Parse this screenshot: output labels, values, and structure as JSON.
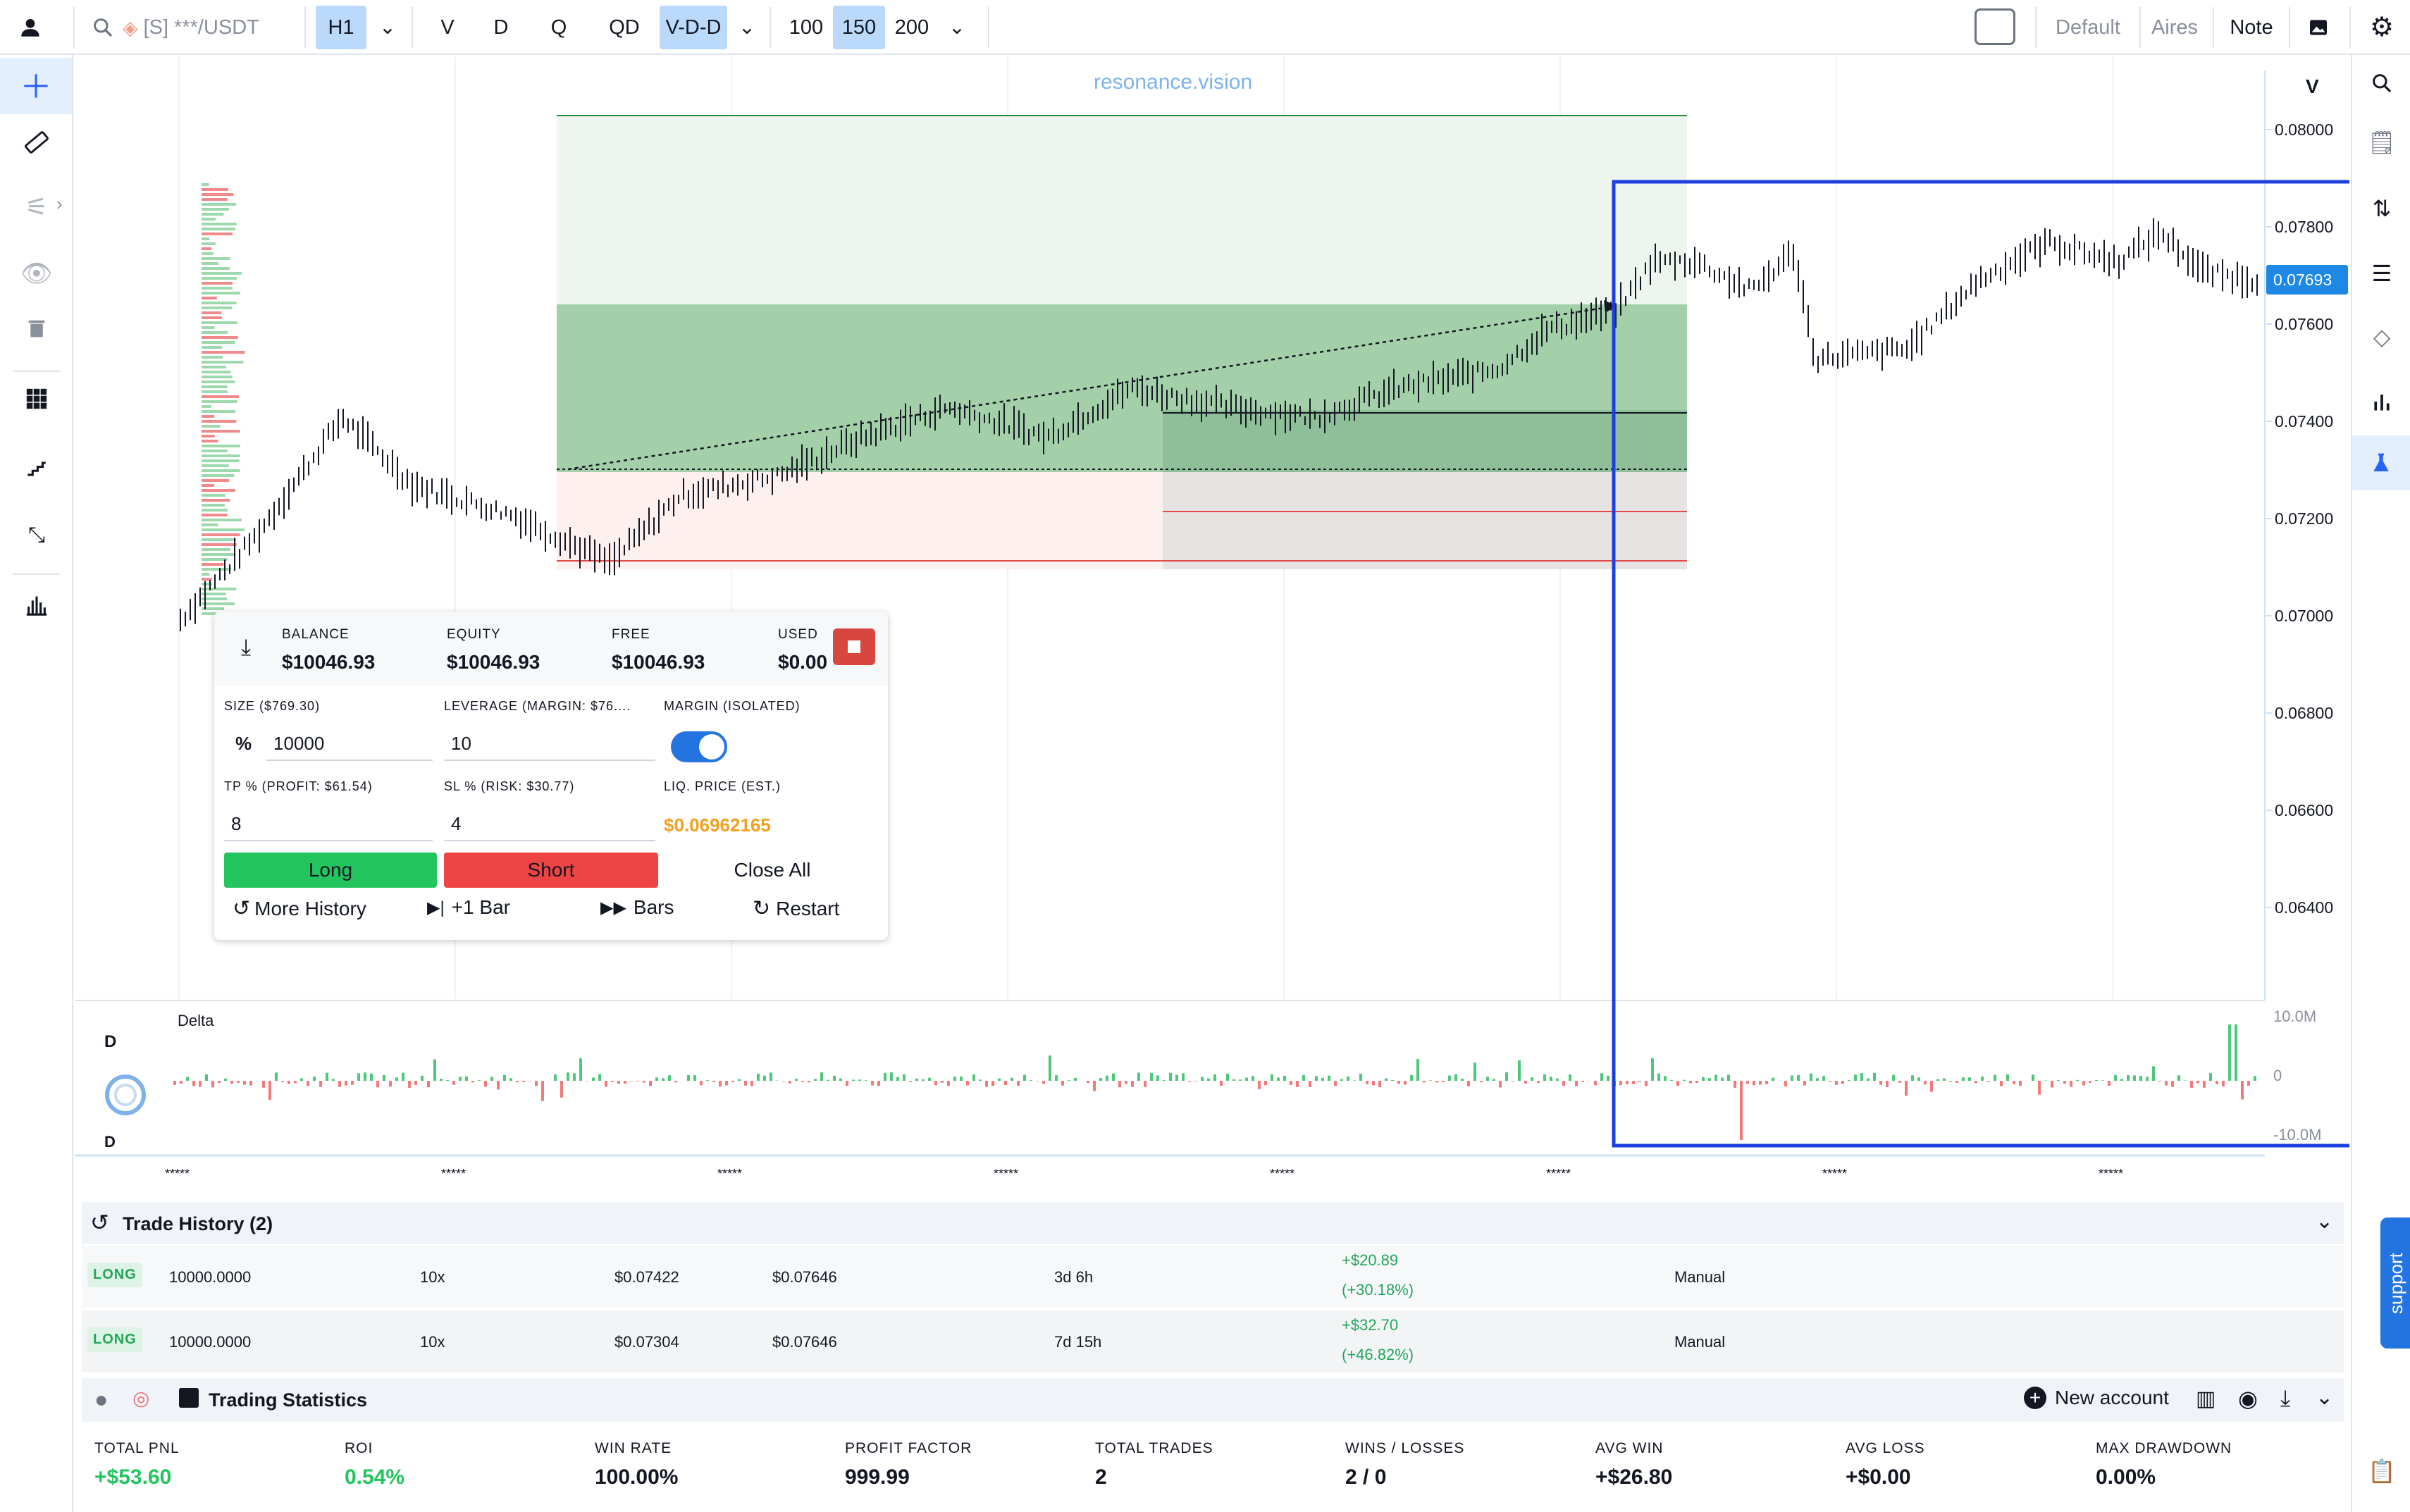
{
  "topbar": {
    "symbol": "[S] ***/USDT",
    "timeframe": "H1",
    "tf_options": [
      "V",
      "D",
      "Q",
      "QD"
    ],
    "vdd": "V-D-D",
    "bars": [
      "100",
      "150",
      "200"
    ],
    "layout_default": "Default",
    "layout_aires": "Aires",
    "note": "Note"
  },
  "chart": {
    "watermark": "resonance.vision",
    "scale_label": "V",
    "price_ticks": [
      "0.08000",
      "0.07800",
      "0.07600",
      "0.07400",
      "0.07200",
      "0.07000",
      "0.06800",
      "0.06600",
      "0.06400"
    ],
    "current_price": "0.07693",
    "x_ticks": [
      "*****",
      "*****",
      "*****",
      "*****",
      "*****",
      "*****",
      "*****",
      "*****"
    ],
    "delta_title": "Delta",
    "delta_ticks": [
      "10.0M",
      "0",
      "-10.0M"
    ],
    "d_label_top": "D",
    "d_label_bottom": "D"
  },
  "trade_panel": {
    "balance_label": "BALANCE",
    "balance": "$10046.93",
    "equity_label": "EQUITY",
    "equity": "$10046.93",
    "free_label": "FREE",
    "free": "$10046.93",
    "used_label": "USED",
    "used": "$0.00",
    "size_label": "SIZE ($769.30)",
    "size_unit": "%",
    "size_value": "10000",
    "leverage_label": "LEVERAGE (MARGIN: $76....",
    "leverage_value": "10",
    "margin_label": "MARGIN (ISOLATED)",
    "tp_label": "TP % (PROFIT: $61.54)",
    "tp_value": "8",
    "sl_label": "SL % (RISK: $30.77)",
    "sl_value": "4",
    "liq_label": "LIQ. PRICE (EST.)",
    "liq_value": "$0.06962165",
    "long": "Long",
    "short": "Short",
    "close_all": "Close All",
    "more_history": "More History",
    "plus_bar": "+1 Bar",
    "bars": "Bars",
    "restart": "Restart"
  },
  "trade_history": {
    "title": "Trade History (2)",
    "rows": [
      {
        "side": "LONG",
        "size": "10000.0000",
        "lev": "10x",
        "entry": "$0.07422",
        "exit": "$0.07646",
        "dur": "3d 6h",
        "pnl": "+$20.89",
        "pct": "(+30.18%)",
        "type": "Manual"
      },
      {
        "side": "LONG",
        "size": "10000.0000",
        "lev": "10x",
        "entry": "$0.07304",
        "exit": "$0.07646",
        "dur": "7d 15h",
        "pnl": "+$32.70",
        "pct": "(+46.82%)",
        "type": "Manual"
      }
    ]
  },
  "statistics": {
    "title": "Trading Statistics",
    "new_account": "New account",
    "items": [
      {
        "label": "TOTAL PNL",
        "value": "+$53.60"
      },
      {
        "label": "ROI",
        "value": "0.54%"
      },
      {
        "label": "WIN RATE",
        "value": "100.00%"
      },
      {
        "label": "PROFIT FACTOR",
        "value": "999.99"
      },
      {
        "label": "TOTAL TRADES",
        "value": "2"
      },
      {
        "label": "WINS / LOSSES",
        "value": "2 / 0"
      },
      {
        "label": "AVG WIN",
        "value": "+$26.80"
      },
      {
        "label": "AVG LOSS",
        "value": "+$0.00"
      },
      {
        "label": "MAX DRAWDOWN",
        "value": "0.00%"
      }
    ]
  },
  "support": "support",
  "colors": {
    "green": "#22c55e",
    "red": "#ef4444",
    "blue": "#1e3fe0",
    "accent": "#2962ff"
  }
}
